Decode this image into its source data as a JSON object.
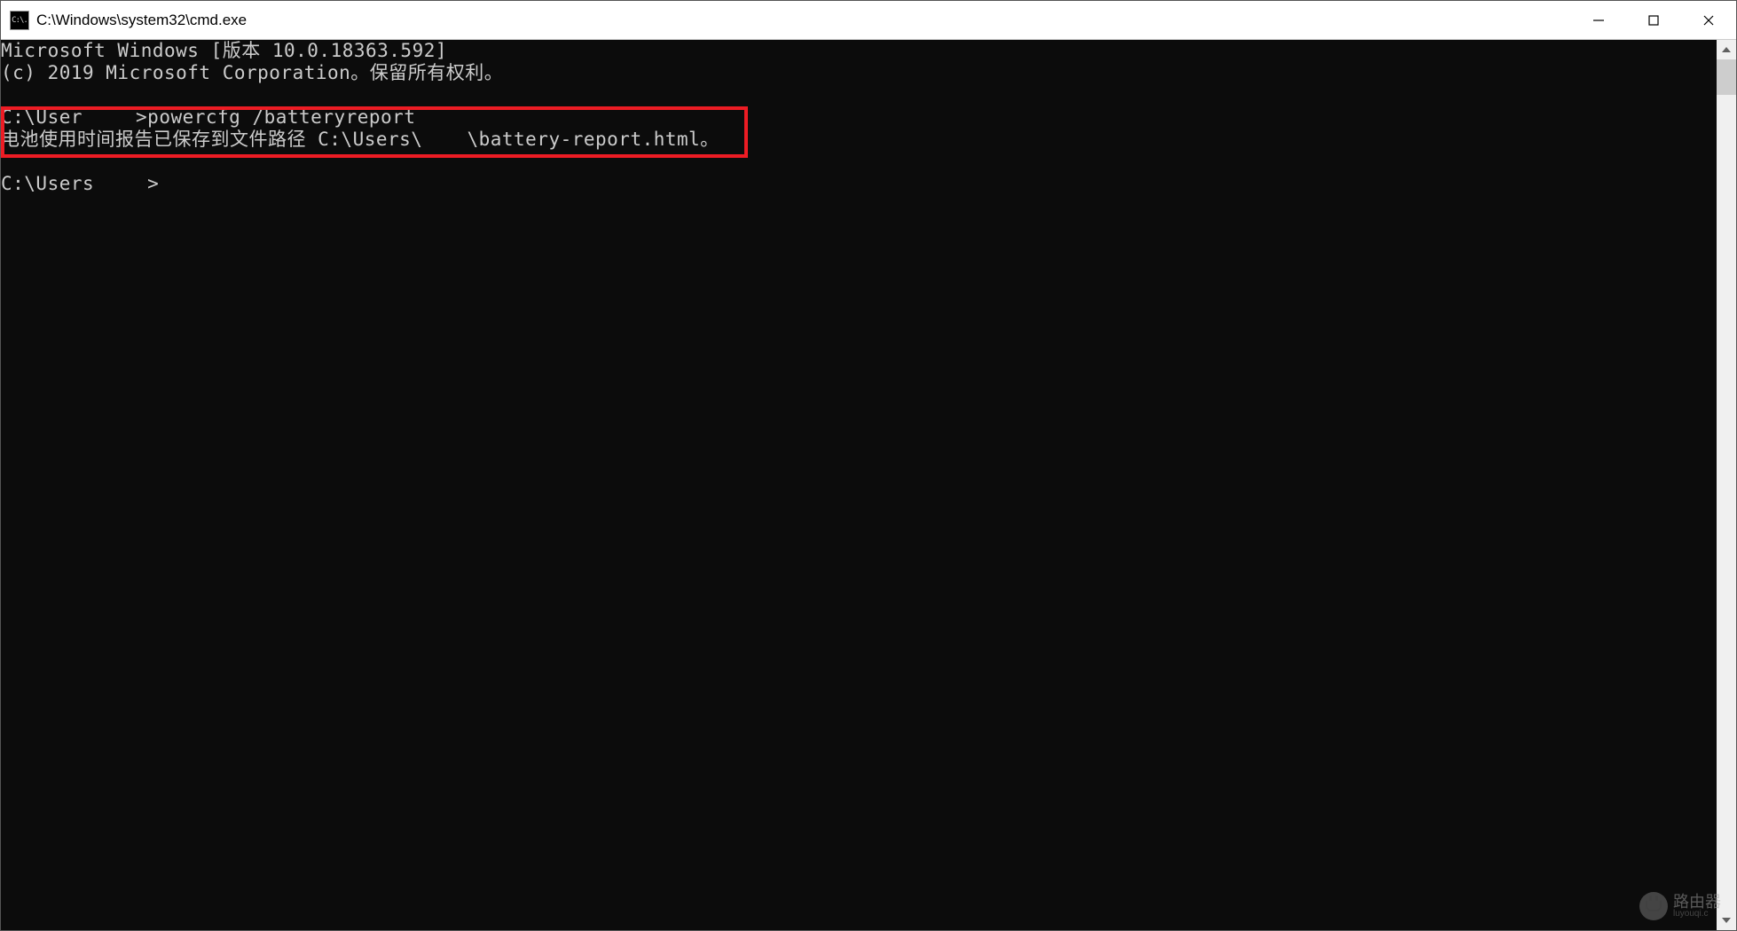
{
  "window": {
    "title": "C:\\Windows\\system32\\cmd.exe",
    "icon_label": "C:\\."
  },
  "terminal": {
    "line1": "Microsoft Windows [版本 10.0.18363.592]",
    "line2": "(c) 2019 Microsoft Corporation。保留所有权利。",
    "prompt1_prefix": "C:\\User",
    "prompt1_suffix": ">",
    "command1": "powercfg /batteryreport",
    "output1_prefix": "电池使用时间报告已保存到文件路径 C:\\Users\\",
    "output1_suffix": "\\battery-report.html。",
    "prompt2_prefix": "C:\\Users",
    "prompt2_suffix": ">"
  },
  "watermark": {
    "main": "路由器",
    "sub": "luyouqi.c"
  }
}
